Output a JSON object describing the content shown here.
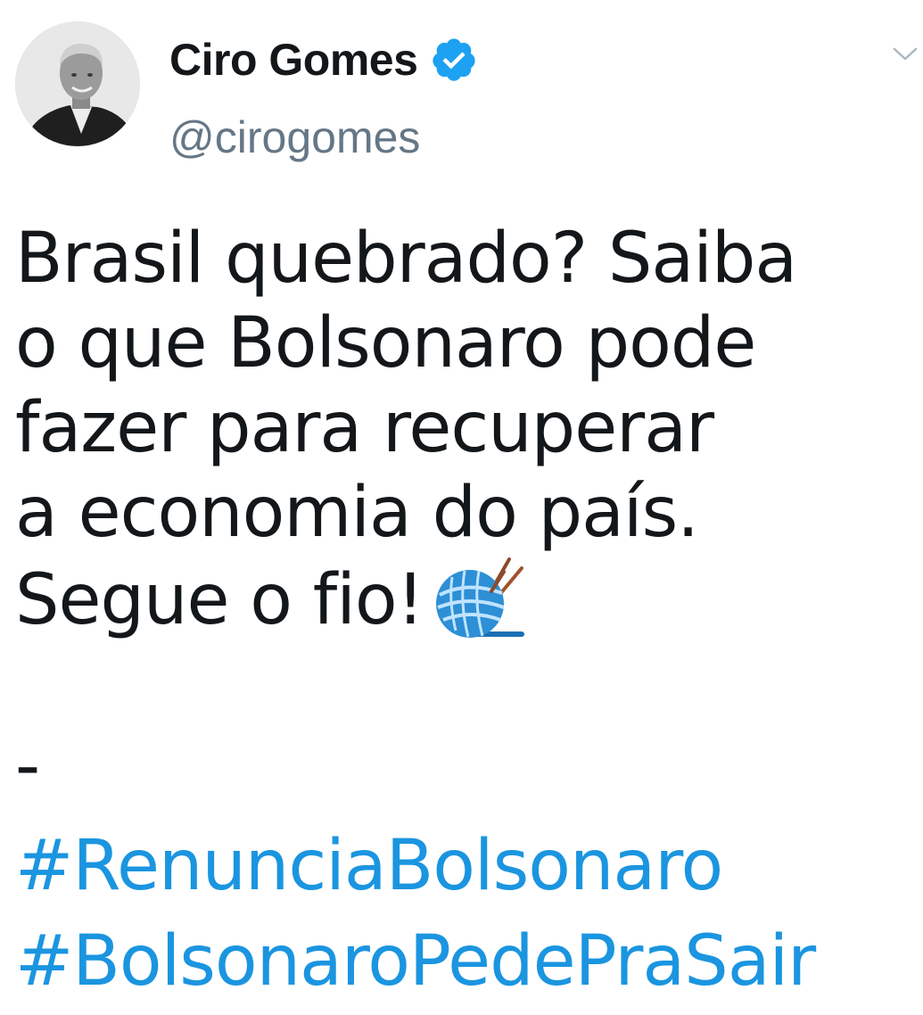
{
  "tweet": {
    "author": {
      "display_name": "Ciro Gomes",
      "handle": "@cirogomes",
      "verified": true,
      "avatar_icon": "profile-photo"
    },
    "body_lines": [
      "Brasil quebrado? Saiba",
      "o que Bolsonaro pode",
      "fazer para recuperar",
      "a economia do país.",
      "Segue o fio!"
    ],
    "emoji": "yarn-ball-icon",
    "separator": "-",
    "hashtags": [
      "#RenunciaBolsonaro",
      "#BolsonaroPedePraSair"
    ],
    "menu_icon": "chevron-down-icon"
  },
  "colors": {
    "text": "#14171a",
    "handle": "#657786",
    "link": "#1b95e0",
    "verified": "#1da1f2",
    "chevron": "#aab8c2"
  }
}
